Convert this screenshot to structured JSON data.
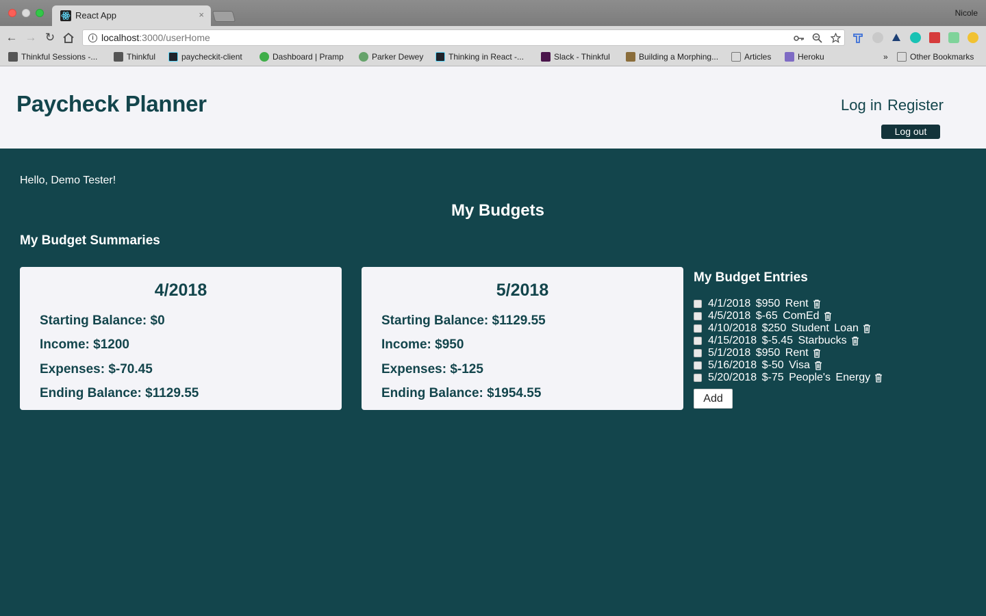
{
  "browser": {
    "tab_title": "React App",
    "tab_close": "×",
    "profile_name": "Nicole",
    "url_host": "localhost",
    "url_path": ":3000/userHome",
    "bookmarks": [
      "Thinkful Sessions -...",
      "Thinkful",
      "paycheckit-client",
      "Dashboard | Pramp",
      "Parker Dewey",
      "Thinking in React -...",
      "Slack - Thinkful",
      "Building a Morphing...",
      "Articles",
      "Heroku"
    ],
    "bookmarks_overflow": "»",
    "other_bookmarks": "Other Bookmarks"
  },
  "header": {
    "brand": "Paycheck Planner",
    "login": "Log in",
    "register": "Register",
    "logout": "Log out"
  },
  "main": {
    "greeting": "Hello, Demo Tester!",
    "title": "My Budgets",
    "summaries_title": "My Budget Summaries",
    "summaries": [
      {
        "month": "4/2018",
        "starting": "Starting Balance: $0",
        "income": "Income: $1200",
        "expenses": "Expenses: $-70.45",
        "ending": "Ending Balance: $1129.55"
      },
      {
        "month": "5/2018",
        "starting": "Starting Balance: $1129.55",
        "income": "Income: $950",
        "expenses": "Expenses: $-125",
        "ending": "Ending Balance: $1954.55"
      }
    ],
    "entries_title": "My Budget Entries",
    "entries": [
      "4/1/2018 $950 Rent",
      "4/5/2018 $-65 ComEd",
      "4/10/2018 $250 Student Loan",
      "4/15/2018 $-5.45 Starbucks",
      "5/1/2018 $950 Rent",
      "5/16/2018 $-50 Visa",
      "5/20/2018 $-75 People's Energy"
    ],
    "add_label": "Add"
  },
  "colors": {
    "background": "#13454c",
    "header_bg": "#f4f4f8",
    "brand": "#13454c",
    "logout_bg": "#13333a"
  }
}
